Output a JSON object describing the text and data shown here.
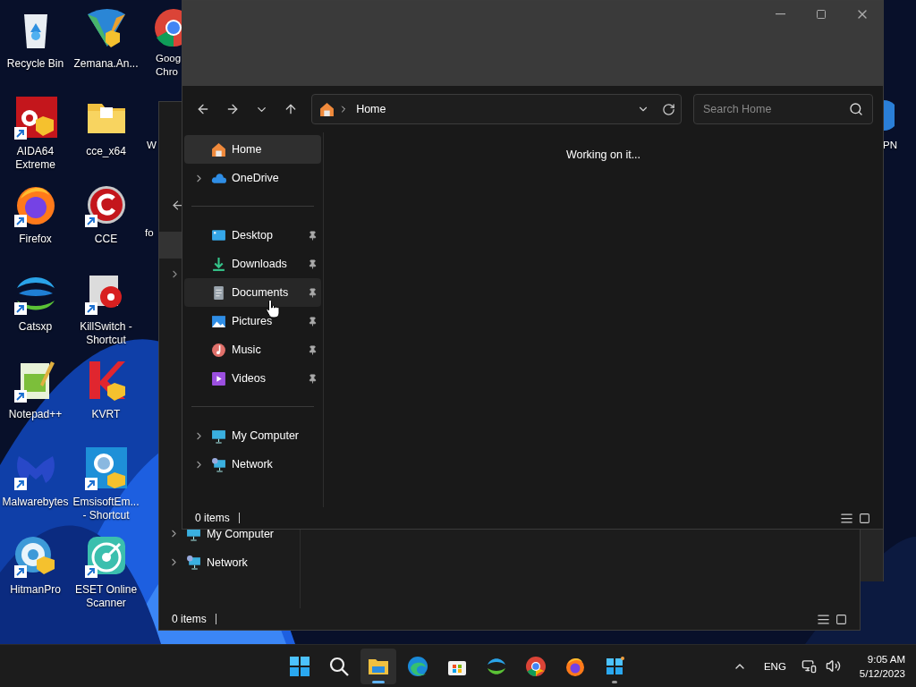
{
  "desktop_icons": [
    {
      "label": "Recycle Bin",
      "shortcut": false
    },
    {
      "label": "AIDA64 Extreme",
      "shortcut": true
    },
    {
      "label": "Firefox",
      "shortcut": true
    },
    {
      "label": "Catsxp",
      "shortcut": true
    },
    {
      "label": "Notepad++",
      "shortcut": true
    },
    {
      "label": "Malwarebytes",
      "shortcut": true
    },
    {
      "label": "HitmanPro",
      "shortcut": true
    },
    {
      "label": "Zemana.An...",
      "shortcut": false
    },
    {
      "label": "cce_x64",
      "shortcut": false
    },
    {
      "label": "CCE",
      "shortcut": true
    },
    {
      "label": "KillSwitch - Shortcut",
      "shortcut": true
    },
    {
      "label": "KVRT",
      "shortcut": false
    },
    {
      "label": "EmsisoftEm... - Shortcut",
      "shortcut": true
    },
    {
      "label": "ESET Online Scanner",
      "shortcut": true
    }
  ],
  "desktop_fragments": [
    {
      "label": "Goog Chro"
    },
    {
      "label": "W"
    },
    {
      "label": "fo"
    },
    {
      "label": "PN"
    }
  ],
  "back_window": {
    "nav": [
      {
        "label": "My Computer",
        "kind": "computer",
        "expandable": true
      },
      {
        "label": "Network",
        "kind": "network",
        "expandable": true
      }
    ],
    "status": "0 items"
  },
  "explorer": {
    "address": "Home",
    "search_placeholder": "Search Home",
    "nav_groups": [
      [
        {
          "label": "Home",
          "kind": "home",
          "expandable": false,
          "pinned": false,
          "selected": true,
          "hovered": false
        },
        {
          "label": "OneDrive",
          "kind": "cloud",
          "expandable": true,
          "pinned": false,
          "selected": false,
          "hovered": false
        }
      ],
      [
        {
          "label": "Desktop",
          "kind": "desktop",
          "expandable": false,
          "pinned": true,
          "selected": false,
          "hovered": false
        },
        {
          "label": "Downloads",
          "kind": "downloads",
          "expandable": false,
          "pinned": true,
          "selected": false,
          "hovered": false
        },
        {
          "label": "Documents",
          "kind": "documents",
          "expandable": false,
          "pinned": true,
          "selected": false,
          "hovered": true
        },
        {
          "label": "Pictures",
          "kind": "pictures",
          "expandable": false,
          "pinned": true,
          "selected": false,
          "hovered": false
        },
        {
          "label": "Music",
          "kind": "music",
          "expandable": false,
          "pinned": true,
          "selected": false,
          "hovered": false
        },
        {
          "label": "Videos",
          "kind": "videos",
          "expandable": false,
          "pinned": true,
          "selected": false,
          "hovered": false
        }
      ],
      [
        {
          "label": "My Computer",
          "kind": "computer",
          "expandable": true,
          "pinned": false,
          "selected": false,
          "hovered": false
        },
        {
          "label": "Network",
          "kind": "network",
          "expandable": true,
          "pinned": false,
          "selected": false,
          "hovered": false
        }
      ]
    ],
    "message": "Working on it...",
    "status": "0 items"
  },
  "taskbar": {
    "apps": [
      {
        "kind": "start",
        "active": false,
        "running": false
      },
      {
        "kind": "search",
        "active": false,
        "running": false
      },
      {
        "kind": "folder",
        "active": true,
        "running": true
      },
      {
        "kind": "edge",
        "active": false,
        "running": false
      },
      {
        "kind": "store",
        "active": false,
        "running": false
      },
      {
        "kind": "wave",
        "active": false,
        "running": false
      },
      {
        "kind": "chrome",
        "active": false,
        "running": false
      },
      {
        "kind": "fox",
        "active": false,
        "running": false
      },
      {
        "kind": "window",
        "active": false,
        "running": true
      }
    ],
    "language": "ENG",
    "time": "9:05 AM",
    "date": "5/12/2023"
  }
}
